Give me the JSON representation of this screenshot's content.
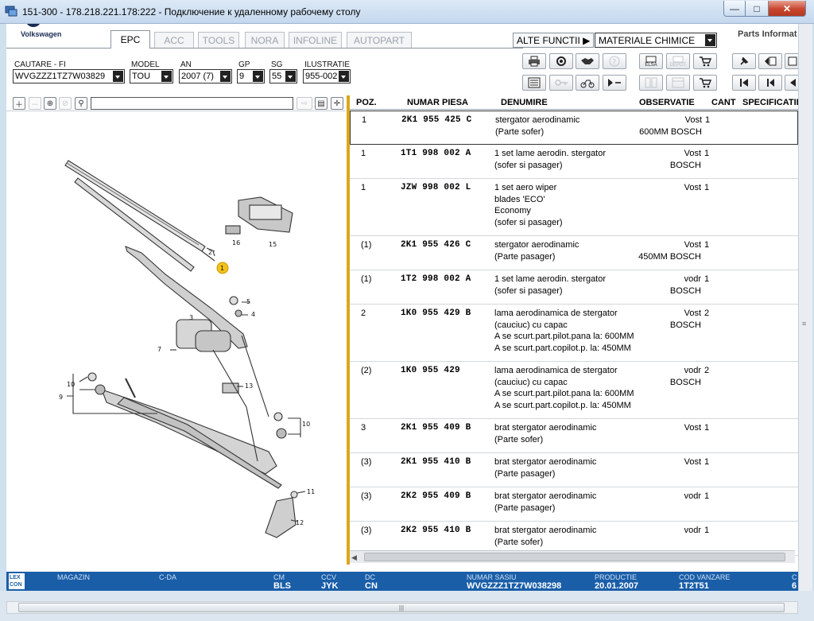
{
  "window": {
    "title": "151-300 - 178.218.221.178:222 - Подключение к удаленному рабочему столу",
    "minimize": "—",
    "maximize": "□",
    "close": "✕"
  },
  "app": {
    "brand": "Volkswagen",
    "parts_info": "Parts Informat",
    "tabs": [
      {
        "label": "EPC",
        "active": true
      },
      {
        "label": "ACC",
        "active": false
      },
      {
        "label": "TOOLS",
        "active": false
      },
      {
        "label": "NORA",
        "active": false
      },
      {
        "label": "INFOLINE",
        "active": false
      },
      {
        "label": "AUTOPART",
        "active": false
      }
    ],
    "alte_functii": "ALTE FUNCTII ▶",
    "materiale": "MATERIALE CHIMICE"
  },
  "search": {
    "cautare": {
      "label": "CAUTARE - FI",
      "value": "WVGZZZ1TZ7W03829"
    },
    "model": {
      "label": "MODEL",
      "value": "TOU"
    },
    "an": {
      "label": "AN",
      "value": "2007 (7)"
    },
    "gp": {
      "label": "GP",
      "value": "9"
    },
    "sg": {
      "label": "SG",
      "value": "55"
    },
    "ilustratie": {
      "label": "ILUSTRATIE",
      "value": "955-002"
    }
  },
  "toolbar": {
    "elsa": "ELSA",
    "depot": "DEPOT"
  },
  "illustration": {
    "callouts": [
      "1",
      "2",
      "3",
      "4",
      "5",
      "7",
      "9",
      "10",
      "11",
      "12",
      "13",
      "15",
      "16",
      "10"
    ]
  },
  "table": {
    "headers": {
      "poz": "POZ.",
      "numar": "NUMAR PIESA",
      "denumire": "DENUMIRE",
      "observatie": "OBSERVATIE",
      "cant": "CANT",
      "spec": "SPECIFICATII M"
    },
    "rows": [
      {
        "poz": "1",
        "numar": "2K1  955  425  C",
        "den": [
          "stergator aerodinamic",
          "(Parte sofer)"
        ],
        "obs": [
          "Vost",
          "600MM   BOSCH"
        ],
        "cant": "1"
      },
      {
        "poz": "1",
        "numar": "1T1  998  002  A",
        "den": [
          "1 set lame aerodin. stergator",
          "(sofer si pasager)"
        ],
        "obs": [
          "Vost",
          "BOSCH"
        ],
        "cant": "1"
      },
      {
        "poz": "1",
        "numar": "JZW  998  002  L",
        "den": [
          "1 set aero wiper",
          "blades              'ECO'",
          "Economy",
          "(sofer si pasager)"
        ],
        "obs": [
          "Vost",
          "",
          "",
          ""
        ],
        "cant": "1"
      },
      {
        "poz": "(1)",
        "numar": "2K1  955  426  C",
        "den": [
          "stergator aerodinamic",
          "(Parte pasager)"
        ],
        "obs": [
          "Vost",
          "450MM   BOSCH"
        ],
        "cant": "1"
      },
      {
        "poz": "(1)",
        "numar": "1T2  998  002  A",
        "den": [
          "1 set lame aerodin. stergator",
          "(sofer si pasager)"
        ],
        "obs": [
          "vodr",
          "BOSCH"
        ],
        "cant": "1"
      },
      {
        "poz": "2",
        "numar": "1K0  955  429  B",
        "den": [
          "lama aerodinamica de stergator",
          "(cauciuc) cu capac",
          "A se scurt.part.pilot.pana la:          600MM",
          "A se scurt.part.copilot.p. la:           450MM"
        ],
        "obs": [
          "Vost",
          "BOSCH",
          "",
          ""
        ],
        "cant": "2"
      },
      {
        "poz": "(2)",
        "numar": "1K0  955  429",
        "den": [
          "lama aerodinamica de stergator",
          "(cauciuc) cu capac",
          "A se scurt.part.pilot.pana la:          600MM",
          "A se scurt.part.copilot.p. la:           450MM"
        ],
        "obs": [
          "vodr",
          "BOSCH",
          "",
          ""
        ],
        "cant": "2"
      },
      {
        "poz": "3",
        "numar": "2K1  955  409  B",
        "den": [
          "brat stergator aerodinamic",
          "(Parte sofer)"
        ],
        "obs": [
          "Vost",
          ""
        ],
        "cant": "1"
      },
      {
        "poz": "(3)",
        "numar": "2K1  955  410  B",
        "den": [
          "brat stergator aerodinamic",
          "(Parte pasager)"
        ],
        "obs": [
          "Vost",
          ""
        ],
        "cant": "1"
      },
      {
        "poz": "(3)",
        "numar": "2K2  955  409  B",
        "den": [
          "brat stergator aerodinamic",
          "(Parte pasager)"
        ],
        "obs": [
          "vodr",
          ""
        ],
        "cant": "1"
      },
      {
        "poz": "(3)",
        "numar": "2K2  955  410  B",
        "den": [
          "brat stergator aerodinamic",
          "(Parte sofer)"
        ],
        "obs": [
          "vodr",
          ""
        ],
        "cant": "1"
      }
    ]
  },
  "status": {
    "lex": "LEX CON",
    "magazin": {
      "label": "MAGAZIN",
      "value": ""
    },
    "cda": {
      "label": "C-DA",
      "value": ""
    },
    "cm": {
      "label": "CM",
      "value": "BLS"
    },
    "ccv": {
      "label": "CCV",
      "value": "JYK"
    },
    "dc": {
      "label": "DC",
      "value": "CN"
    },
    "sasiu": {
      "label": "NUMAR SASIU",
      "value": "WVGZZZ1TZ7W038298"
    },
    "productie": {
      "label": "PRODUCTIE",
      "value": "20.01.2007"
    },
    "cod": {
      "label": "COD VANZARE",
      "value": "1T2T51"
    },
    "extra": {
      "label": "C",
      "value": "6"
    }
  },
  "colors": {
    "status_bar": "#1a5ea8",
    "divider": "#d9a81c",
    "callout": "#f2c21b"
  }
}
